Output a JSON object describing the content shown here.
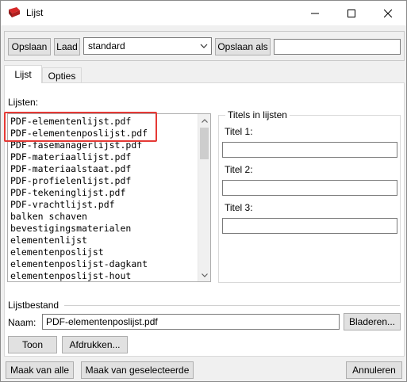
{
  "window": {
    "title": "Lijst"
  },
  "toolbar": {
    "save_label": "Opslaan",
    "load_label": "Laad",
    "profile_value": "standard",
    "save_as_label": "Opslaan als",
    "save_as_value": ""
  },
  "tabs": [
    {
      "label": "Lijst",
      "active": true
    },
    {
      "label": "Opties",
      "active": false
    }
  ],
  "lists": {
    "label": "Lijsten:",
    "items": [
      "PDF-elementenlijst.pdf",
      "PDF-elementenposlijst.pdf",
      "PDF-fasemanagerlijst.pdf",
      "PDF-materiaallijst.pdf",
      "PDF-materiaalstaat.pdf",
      "PDF-profielenlijst.pdf",
      "PDF-tekeninglijst.pdf",
      "PDF-vrachtlijst.pdf",
      "balken schaven",
      "bevestigingsmaterialen",
      "elementenlijst",
      "elementenposlijst",
      "elementenposlijst-dagkant",
      "elementenposlijst-hout"
    ]
  },
  "titles": {
    "group_label": "Titels in lijsten",
    "title1_label": "Titel 1:",
    "title1_value": "",
    "title2_label": "Titel 2:",
    "title2_value": "",
    "title3_label": "Titel 3:",
    "title3_value": ""
  },
  "file": {
    "section_label": "Lijstbestand",
    "name_label": "Naam:",
    "name_value": "PDF-elementenposlijst.pdf",
    "browse_label": "Bladeren...",
    "show_label": "Toon",
    "print_label": "Afdrukken..."
  },
  "bottom": {
    "make_all_label": "Maak van alle",
    "make_selected_label": "Maak van geselecteerde",
    "cancel_label": "Annuleren"
  },
  "colors": {
    "highlight": "#e53935",
    "app_icon": "#d62828"
  }
}
